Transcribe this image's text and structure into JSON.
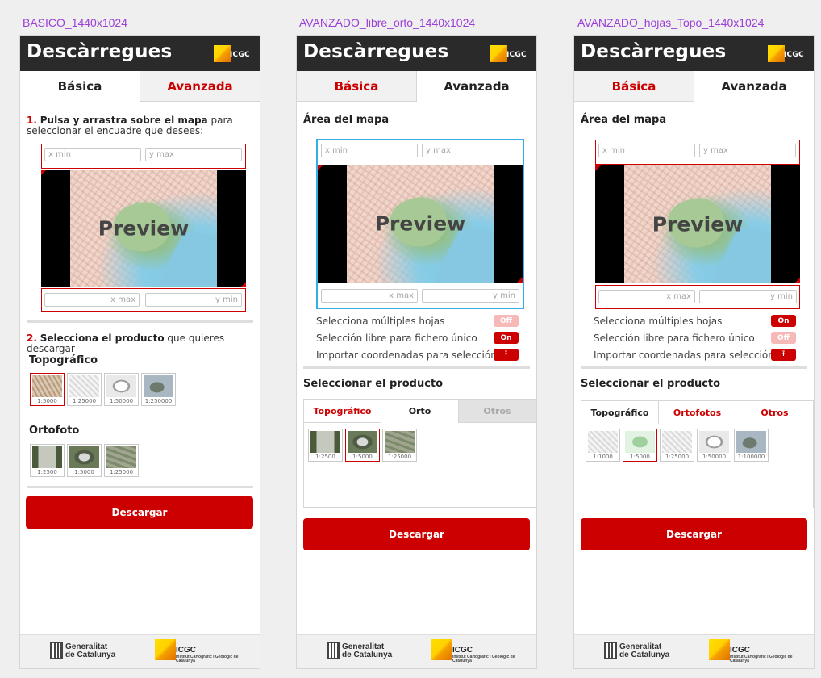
{
  "frames": [
    {
      "label": "BASICO_1440x1024",
      "header": {
        "title": "Descàrregues",
        "logo_text": "ICGC"
      },
      "tabs": {
        "basic": "Básica",
        "advanced": "Avanzada"
      },
      "step1": {
        "num": "1.",
        "bold": "Pulsa y arrastra sobre el mapa",
        "rest": " para seleccionar el encuadre que desees:"
      },
      "coords": {
        "x_min": "x min",
        "y_max": "y max",
        "x_max": "x max",
        "y_min": "y min"
      },
      "preview": "Preview",
      "step2": {
        "num": "2.",
        "bold": "Selecciona el producto",
        "rest": " que quieres descargar"
      },
      "topo": {
        "title": "Topográfico",
        "scales": [
          "1:5000",
          "1:25000",
          "1:50000",
          "1:250000"
        ],
        "selected": 0
      },
      "ortho": {
        "title": "Ortofoto",
        "scales": [
          "1:2500",
          "1:5000",
          "1:25000"
        ]
      },
      "download": "Descargar"
    },
    {
      "label": "AVANZADO_libre_orto_1440x1024",
      "header": {
        "title": "Descàrregues",
        "logo_text": "ICGC"
      },
      "tabs": {
        "basic": "Básica",
        "advanced": "Avanzada"
      },
      "area_title": "Área del mapa",
      "coords": {
        "x_min": "x min",
        "y_max": "y max",
        "x_max": "x max",
        "y_min": "y min"
      },
      "preview": "Preview",
      "options": [
        {
          "label": "Selecciona múltiples hojas",
          "state": "Off"
        },
        {
          "label": "Selección libre para fichero único",
          "state": "On"
        },
        {
          "label": "Importar coordenadas para selección",
          "state": "upload"
        }
      ],
      "product_title": "Seleccionar el producto",
      "product_tabs": [
        "Topográfico",
        "Orto",
        "Otros"
      ],
      "scales": [
        "1:2500",
        "1:5000",
        "1:25000"
      ],
      "selected": 1,
      "download": "Descargar"
    },
    {
      "label": "AVANZADO_hojas_Topo_1440x1024",
      "header": {
        "title": "Descàrregues",
        "logo_text": "ICGC"
      },
      "tabs": {
        "basic": "Básica",
        "advanced": "Avanzada"
      },
      "area_title": "Área del mapa",
      "coords": {
        "x_min": "x min",
        "y_max": "y max",
        "x_max": "x max",
        "y_min": "y min"
      },
      "preview": "Preview",
      "options": [
        {
          "label": "Selecciona múltiples hojas",
          "state": "On"
        },
        {
          "label": "Selección libre para fichero único",
          "state": "Off"
        },
        {
          "label": "Importar coordenadas para selección",
          "state": "upload"
        }
      ],
      "product_title": "Seleccionar el producto",
      "product_tabs": [
        "Topográfico",
        "Ortofotos",
        "Otros"
      ],
      "scales": [
        "1:1000",
        "1:5000",
        "1:25000",
        "1:50000",
        "1:100000"
      ],
      "selected": 1,
      "download": "Descargar"
    }
  ],
  "footer": {
    "gen_line1": "Generalitat",
    "gen_line2": "de Catalunya",
    "icgc": "ICGC",
    "icgc_sub": "Institut Cartogràfic i Geològic de Catalunya"
  },
  "colors": {
    "accent": "#cc0000",
    "header_bg": "#2a2a2a",
    "selection_blue": "#35aee8",
    "frame_label": "#9b3fd6"
  }
}
